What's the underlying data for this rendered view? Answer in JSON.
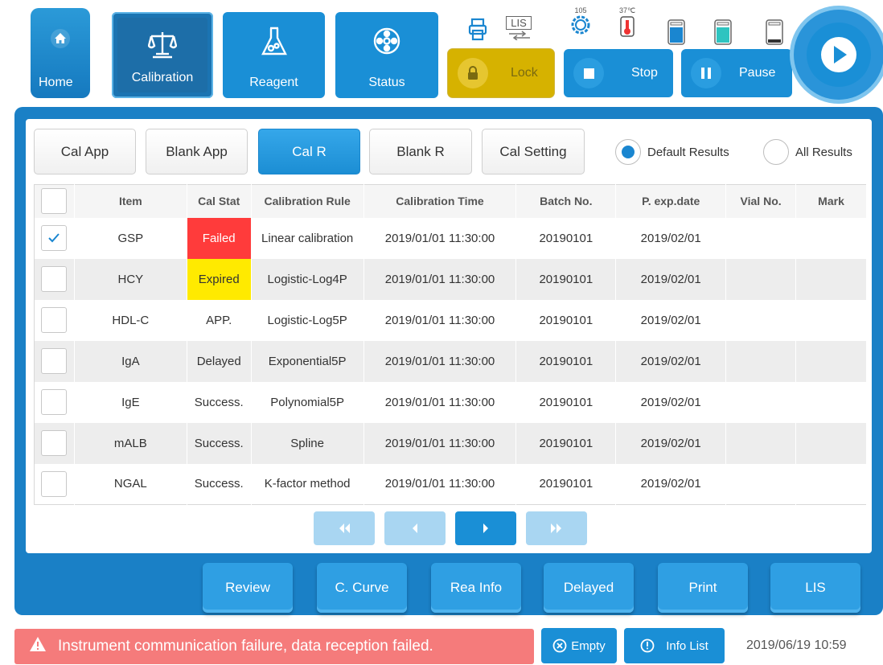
{
  "nav": {
    "home": "Home",
    "calibration": "Calibration",
    "reagent": "Reagent",
    "status": "Status"
  },
  "indicators": {
    "printer_icon": "printer-icon",
    "lis_label": "LIS",
    "gear_value": "105",
    "temp_value": "37℃"
  },
  "tools": {
    "lock": "Lock",
    "stop": "Stop",
    "pause": "Pause"
  },
  "tabs": [
    "Cal App",
    "Blank App",
    "Cal R",
    "Blank R",
    "Cal Setting"
  ],
  "active_tab": "Cal R",
  "filters": {
    "default_results": "Default Results",
    "all_results": "All Results",
    "selected": "Default Results"
  },
  "table": {
    "headers": [
      "",
      "Item",
      "Cal Stat",
      "Calibration Rule",
      "Calibration Time",
      "Batch No.",
      "P. exp.date",
      "Vial No.",
      "Mark"
    ],
    "rows": [
      {
        "checked": true,
        "item": "GSP",
        "stat": "Failed",
        "rule": "Linear calibration",
        "time": "2019/01/01 11:30:00",
        "batch": "20190101",
        "exp": "2019/02/01",
        "vial": "",
        "mark": ""
      },
      {
        "checked": false,
        "item": "HCY",
        "stat": "Expired",
        "rule": "Logistic-Log4P",
        "time": "2019/01/01 11:30:00",
        "batch": "20190101",
        "exp": "2019/02/01",
        "vial": "",
        "mark": ""
      },
      {
        "checked": false,
        "item": "HDL-C",
        "stat": "APP.",
        "rule": "Logistic-Log5P",
        "time": "2019/01/01 11:30:00",
        "batch": "20190101",
        "exp": "2019/02/01",
        "vial": "",
        "mark": ""
      },
      {
        "checked": false,
        "item": "IgA",
        "stat": "Delayed",
        "rule": "Exponential5P",
        "time": "2019/01/01 11:30:00",
        "batch": "20190101",
        "exp": "2019/02/01",
        "vial": "",
        "mark": ""
      },
      {
        "checked": false,
        "item": "IgE",
        "stat": "Success.",
        "rule": "Polynomial5P",
        "time": "2019/01/01 11:30:00",
        "batch": "20190101",
        "exp": "2019/02/01",
        "vial": "",
        "mark": ""
      },
      {
        "checked": false,
        "item": "mALB",
        "stat": "Success.",
        "rule": "Spline",
        "time": "2019/01/01 11:30:00",
        "batch": "20190101",
        "exp": "2019/02/01",
        "vial": "",
        "mark": ""
      },
      {
        "checked": false,
        "item": "NGAL",
        "stat": "Success.",
        "rule": "K-factor method",
        "time": "2019/01/01 11:30:00",
        "batch": "20190101",
        "exp": "2019/02/01",
        "vial": "",
        "mark": ""
      }
    ]
  },
  "actions": [
    "Review",
    "C. Curve",
    "Rea Info",
    "Delayed",
    "Print",
    "LIS"
  ],
  "status_bar": {
    "alert": "Instrument communication failure, data reception failed.",
    "empty": "Empty",
    "info_list": "Info List",
    "datetime": "2019/06/19 10:59"
  },
  "colors": {
    "primary": "#1a8fd6",
    "failed": "#ff3b3b",
    "expired": "#ffea00",
    "alert": "#f57b7b",
    "lock": "#d6b200"
  }
}
